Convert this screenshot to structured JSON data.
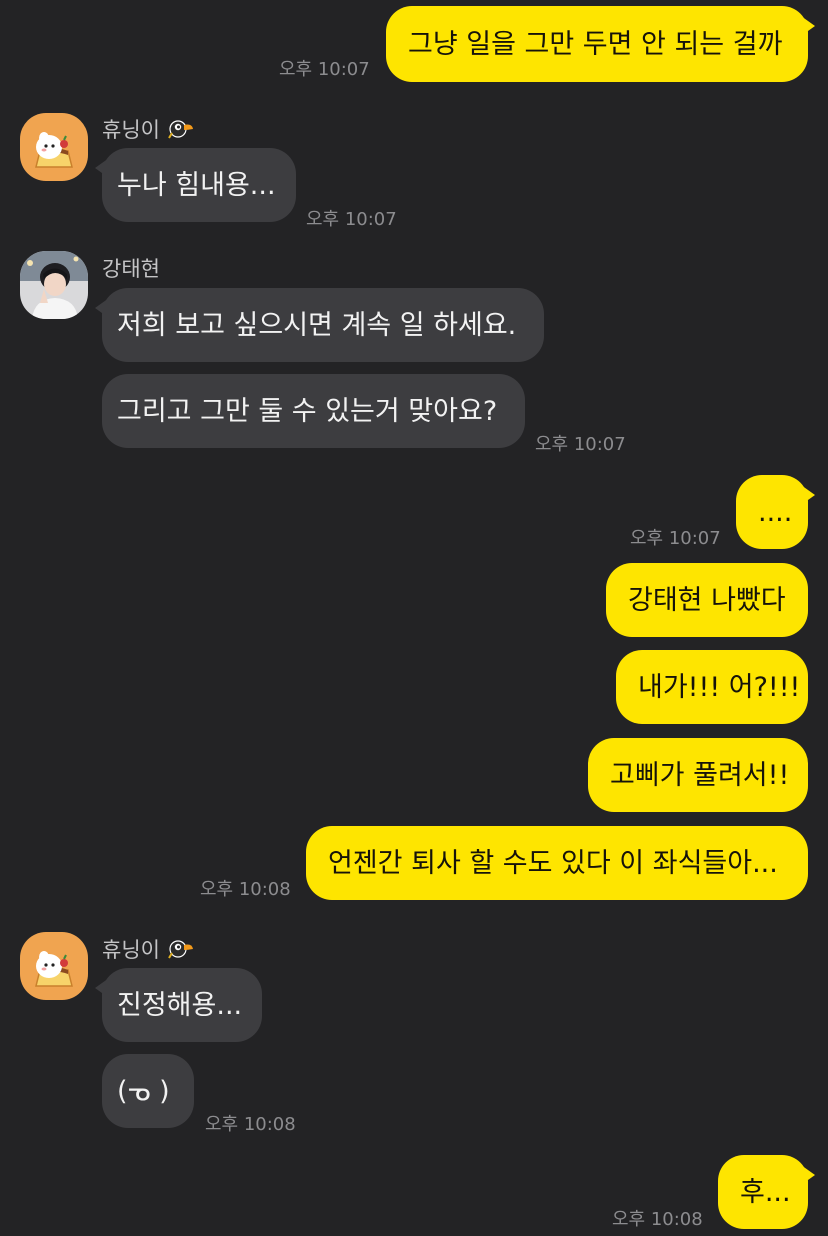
{
  "messages": {
    "m1": {
      "text": "그냥 일을 그만 두면 안 되는 걸까",
      "time": "오후 10:07"
    },
    "m2": {
      "sender": "휴닝이",
      "text": "누나 힘내용...",
      "time": "오후 10:07"
    },
    "m3": {
      "sender": "강태현",
      "text": "저희 보고 싶으시면 계속 일 하세요."
    },
    "m4": {
      "text": "그리고 그만 둘 수 있는거 맞아요?",
      "time": "오후 10:07"
    },
    "m5": {
      "text": "....",
      "time": "오후 10:07"
    },
    "m6": {
      "text": "강태현 나빴다"
    },
    "m7": {
      "text": "내가!!! 어?!!!"
    },
    "m8": {
      "text": "고삐가 풀려서!!"
    },
    "m9": {
      "text": "언젠간 퇴사 할 수도 있다 이 좌식들아...",
      "time": "오후 10:08"
    },
    "m10": {
      "sender": "휴닝이",
      "text": "진정해용..."
    },
    "m11": {
      "text": "(ᓀ )",
      "time": "오후 10:08"
    },
    "m12": {
      "text": "후...",
      "time": "오후 10:08"
    }
  },
  "icons": {
    "pudding_avatar": "pudding-avatar-icon",
    "profile_photo": "profile-photo-avatar",
    "toucan_badge": "toucan-badge-icon"
  },
  "colors": {
    "background": "#232325",
    "my_bubble": "#fee500",
    "their_bubble": "#3d3d40",
    "time_text": "#8c8c8f",
    "avatar_orange": "#f0a450"
  }
}
